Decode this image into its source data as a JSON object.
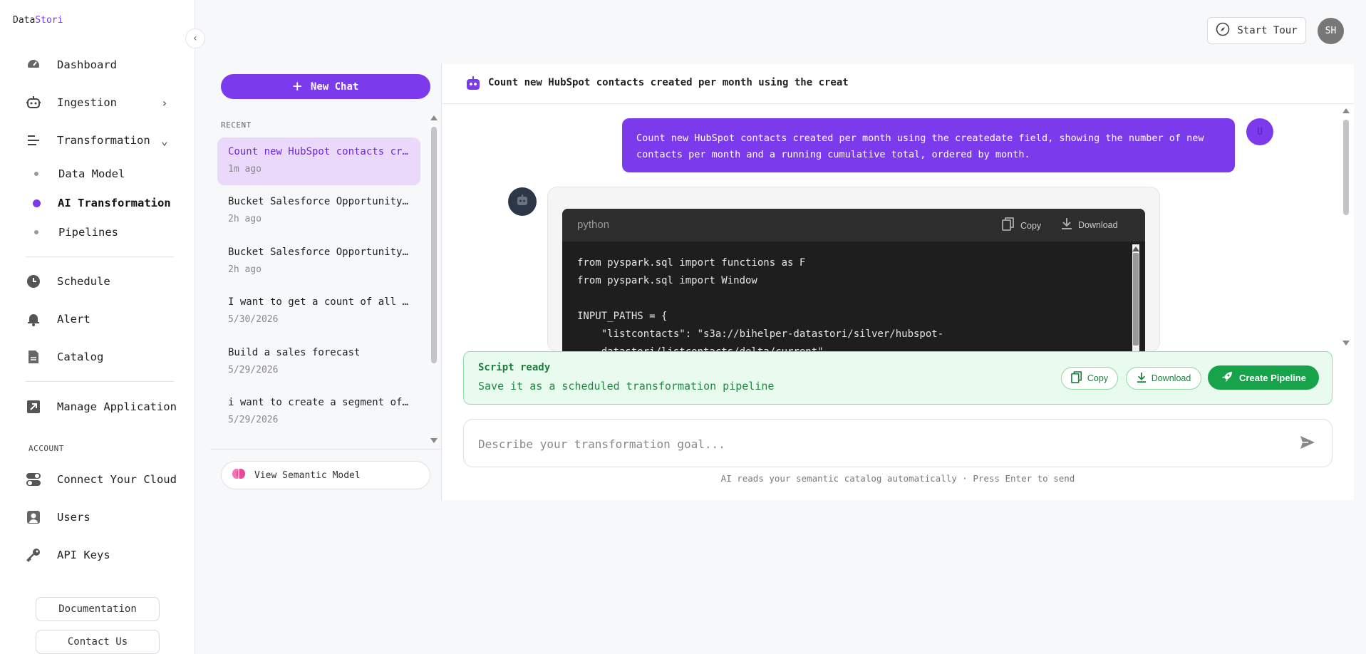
{
  "app": {
    "logo_part1": "Data",
    "logo_part2": "Stori"
  },
  "sidebar": {
    "items": [
      {
        "label": "Dashboard",
        "icon": "gauge-icon"
      },
      {
        "label": "Ingestion",
        "icon": "robot-icon"
      },
      {
        "label": "Transformation",
        "icon": "lines-icon"
      }
    ],
    "sub_items": [
      {
        "label": "Data Model"
      },
      {
        "label": "AI Transformation"
      },
      {
        "label": "Pipelines"
      }
    ],
    "items2": [
      {
        "label": "Schedule",
        "icon": "clock-icon"
      },
      {
        "label": "Alert",
        "icon": "bell-icon"
      },
      {
        "label": "Catalog",
        "icon": "document-icon"
      }
    ],
    "manage": {
      "label": "Manage Application",
      "icon": "external-link-icon"
    },
    "account_label": "ACCOUNT",
    "account_items": [
      {
        "label": "Connect Your Cloud",
        "icon": "toggle-icon"
      },
      {
        "label": "Users",
        "icon": "user-icon"
      },
      {
        "label": "API Keys",
        "icon": "key-icon"
      }
    ],
    "documentation_label": "Documentation",
    "contact_label": "Contact Us"
  },
  "topbar": {
    "start_tour_label": "Start Tour",
    "avatar_initials": "SH"
  },
  "history": {
    "new_chat_label": "New Chat",
    "recent_label": "RECENT",
    "items": [
      {
        "title": "Count new HubSpot contacts created per month using the createdate field",
        "date": "1m ago"
      },
      {
        "title": "Bucket Salesforce Opportunity deals by amount",
        "date": "2h ago"
      },
      {
        "title": "Bucket Salesforce Opportunity deals by stage",
        "date": "2h ago"
      },
      {
        "title": "I want to get a count of all the contacts",
        "date": "5/30/2026"
      },
      {
        "title": "Build a sales forecast",
        "date": "5/29/2026"
      },
      {
        "title": "i want to create a segment of prospects",
        "date": "5/29/2026"
      }
    ],
    "view_semantic_label": "View Semantic Model"
  },
  "chat": {
    "title": "Count new HubSpot contacts created per month using the creat",
    "user_message": "Count new HubSpot contacts created per month using the createdate field, showing the number of new contacts per month and a running cumulative total, ordered by month.",
    "user_avatar": "U",
    "code": {
      "language": "python",
      "copy_label": "Copy",
      "download_label": "Download",
      "content": "from pyspark.sql import functions as F\nfrom pyspark.sql import Window\n\nINPUT_PATHS = {\n    \"listcontacts\": \"s3a://bihelper-datastori/silver/hubspot-\n    datastori/listcontacts/delta/current\""
    },
    "script_ready": {
      "title": "Script ready",
      "subtitle": "Save it as a scheduled transformation pipeline",
      "copy_label": "Copy",
      "download_label": "Download",
      "create_label": "Create Pipeline"
    },
    "input_placeholder": "Describe your transformation goal...",
    "input_value": "",
    "hint": "AI reads your semantic catalog automatically · Press Enter to send"
  },
  "colors": {
    "accent": "#7c3aed",
    "success": "#16a34a",
    "code_bg": "#1e1e1e"
  }
}
